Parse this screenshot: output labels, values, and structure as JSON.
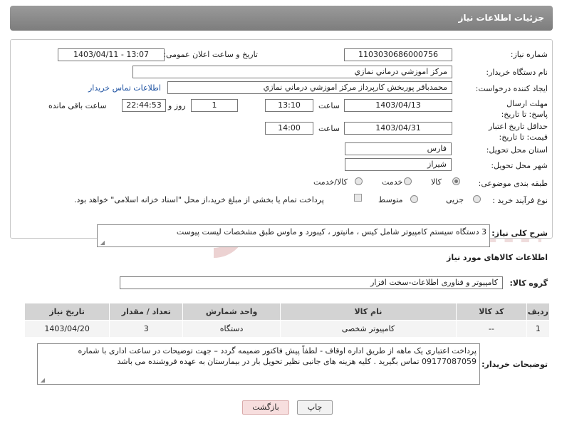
{
  "header": {
    "title": "جزئیات اطلاعات نیاز"
  },
  "fields": {
    "need_number_label": "شماره نیاز:",
    "need_number": "1103030686000756",
    "announce_label": "تاریخ و ساعت اعلان عمومی:",
    "announce_value": "1403/04/11 - 13:07",
    "buyer_label": "نام دستگاه خریدار:",
    "buyer_value": "مرکز اموزشي درماني نمازي",
    "creator_label": "ایجاد کننده درخواست:",
    "creator_value": "محمدباقر پوربخش کارپرداز مرکز اموزشي درماني نمازي",
    "contact_link": "اطلاعات تماس خریدار",
    "reply_deadline_label": "مهلت ارسال پاسخ: تا تاریخ:",
    "reply_date": "1403/04/13",
    "time_label": "ساعت",
    "reply_time": "13:10",
    "days_value": "1",
    "days_label": "روز و",
    "remaining_time": "22:44:53",
    "remaining_label": "ساعت باقی مانده",
    "price_validity_label": "حداقل تاریخ اعتبار قیمت: تا تاریخ:",
    "validity_date": "1403/04/31",
    "validity_time": "14:00",
    "province_label": "استان محل تحویل:",
    "province_value": "فارس",
    "city_label": "شهر محل تحویل:",
    "city_value": "شیراز",
    "category_label": "طبقه بندی موضوعی:",
    "cat_goods": "کالا",
    "cat_service": "خدمت",
    "cat_goods_service": "کالا/خدمت",
    "process_label": "نوع فرآیند خرید :",
    "proc_minor": "جزیی",
    "proc_medium": "متوسط",
    "payment_note": "پرداخت تمام یا بخشی از مبلغ خرید،از محل \"اسناد خزانه اسلامی\" خواهد بود."
  },
  "description": {
    "label": "شرح کلی نیاز:",
    "value": "3 دستگاه سیستم کامپیوتر شامل کیس ، مانیتور ، کیبورد و ماوس طبق مشخصات لیست پیوست"
  },
  "goods": {
    "section_title": "اطلاعات کالاهای مورد نیاز",
    "group_label": "گروه کالا:",
    "group_value": "کامپیوتر و فناوری اطلاعات-سخت افزار",
    "columns": [
      "ردیف",
      "کد کالا",
      "نام کالا",
      "واحد شمارش",
      "تعداد / مقدار",
      "تاریخ نیاز"
    ],
    "rows": [
      [
        "1",
        "--",
        "کامپیوتر شخصی",
        "دستگاه",
        "3",
        "1403/04/20"
      ]
    ]
  },
  "buyer_notes": {
    "label": "توضیحات خریدار:",
    "value": "پرداخت اعتباری یک ماهه از طریق اداره اوقاف - لطفاً پیش فاکتور ضمیمه گردد – جهت توضیحات در ساعت اداری با شماره 09177087059 تماس بگیرید . کلیه هزینه های جانبی نظیر تحویل بار در بیمارستان به عهده فروشنده می باشد"
  },
  "buttons": {
    "print": "چاپ",
    "back": "بازگشت"
  },
  "watermark": {
    "text": "AriaTender.neT"
  },
  "colors": {
    "header": "#8a8a8a",
    "link": "#1a4fa0",
    "back_button": "#f7dede",
    "watermark": "#e9c9c9"
  }
}
